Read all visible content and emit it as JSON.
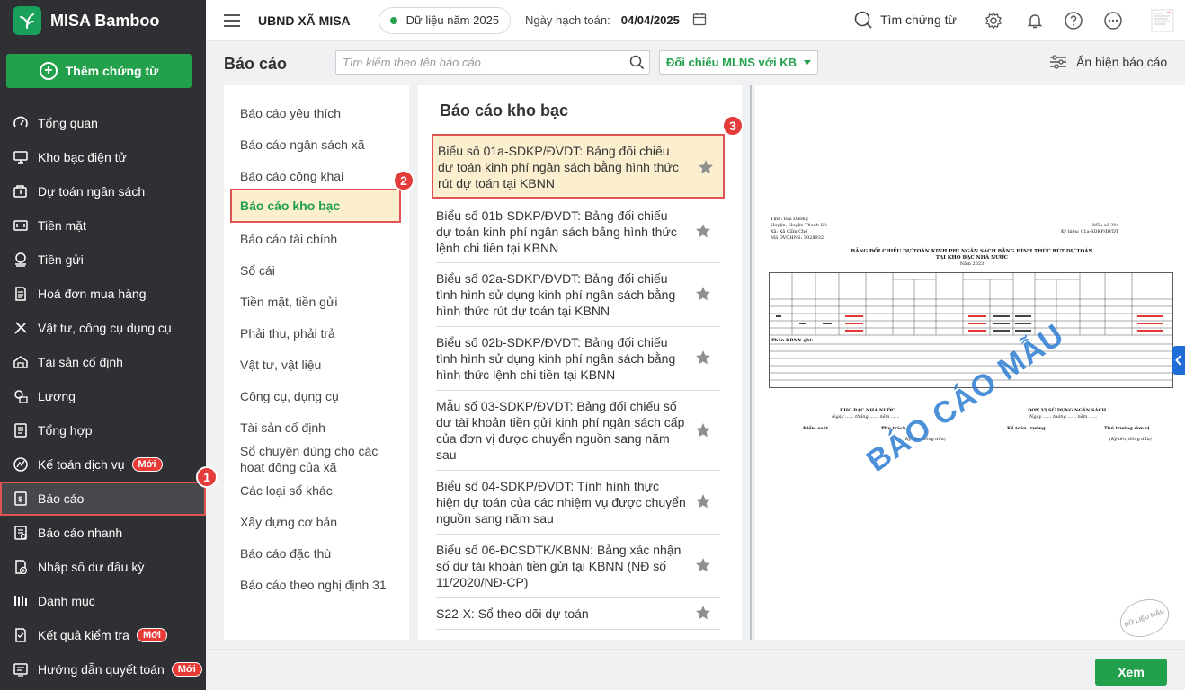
{
  "app": {
    "name": "MISA Bamboo"
  },
  "sidebar": {
    "add_button": "Thêm chứng từ",
    "items": [
      {
        "label": "Tổng quan",
        "icon": "dashboard-icon"
      },
      {
        "label": "Kho bạc điện tử",
        "icon": "monitor-icon"
      },
      {
        "label": "Dự toán ngân sách",
        "icon": "budget-icon"
      },
      {
        "label": "Tiền mặt",
        "icon": "cash-icon"
      },
      {
        "label": "Tiền gửi",
        "icon": "coins-icon"
      },
      {
        "label": "Hoá đơn mua hàng",
        "icon": "invoice-icon"
      },
      {
        "label": "Vật tư, công cụ dụng cụ",
        "icon": "tools-icon"
      },
      {
        "label": "Tài sản cố định",
        "icon": "building-icon"
      },
      {
        "label": "Lương",
        "icon": "salary-icon"
      },
      {
        "label": "Tổng hợp",
        "icon": "summary-icon"
      },
      {
        "label": "Kế toán dịch vụ",
        "icon": "service-icon",
        "badge": "Mới"
      },
      {
        "label": "Báo cáo",
        "icon": "report-icon",
        "active": true
      },
      {
        "label": "Báo cáo nhanh",
        "icon": "quick-report-icon"
      },
      {
        "label": "Nhập số dư đầu kỳ",
        "icon": "opening-balance-icon"
      },
      {
        "label": "Danh mục",
        "icon": "catalog-icon"
      },
      {
        "label": "Kết quả kiểm tra",
        "icon": "check-result-icon",
        "badge": "Mới"
      },
      {
        "label": "Hướng dẫn quyết toán",
        "icon": "guide-icon",
        "badge": "Mới"
      }
    ]
  },
  "topbar": {
    "org": "UBND XÃ MISA",
    "data_year": "Dữ liệu năm 2025",
    "posting_date_label": "Ngày hạch toán:",
    "posting_date": "04/04/2025",
    "search_label": "Tìm chứng từ"
  },
  "header": {
    "title": "Báo cáo",
    "search_placeholder": "Tìm kiếm theo tên báo cáo",
    "dropdown": "Đối chiếu MLNS với KB",
    "toggle_label": "Ẩn hiện báo cáo"
  },
  "categories": [
    "Báo cáo yêu thích",
    "Báo cáo ngân sách xã",
    "Báo cáo công khai",
    "Báo cáo kho bạc",
    "Báo cáo tài chính",
    "Sổ cái",
    "Tiền mặt, tiền gửi",
    "Phải thu, phải trả",
    "Vật tư, vật liệu",
    "Công cụ, dụng cụ",
    "Tài sản cố định",
    "Sổ chuyên dùng cho các hoạt động của xã",
    "Các loại sổ khác",
    "Xây dựng cơ bản",
    "Báo cáo đặc thù",
    "Báo cáo theo nghị định 31"
  ],
  "report_list": {
    "title": "Báo cáo kho bạc",
    "items": [
      "Biểu số 01a-SDKP/ĐVDT: Bảng đối chiếu dự toán kinh phí ngân sách bằng hình thức rút dự toán tại KBNN",
      "Biểu số 01b-SDKP/ĐVDT: Bảng đối chiếu dự toán kinh phí ngân sách bằng hình thức lệnh chi tiền tại KBNN",
      "Biểu số 02a-SDKP/ĐVDT: Bảng đối chiếu tình hình sử dụng kinh phí ngân sách bằng hình thức rút dự toán tại KBNN",
      "Biểu số 02b-SDKP/ĐVDT: Bảng đối chiếu tình hình sử dụng kinh phí ngân sách bằng hình thức lệnh chi tiền tại KBNN",
      "Mẫu số 03-SDKP/ĐVDT: Bảng đối chiếu số dư tài khoản tiền gửi kinh phí ngân sách cấp của đơn vị được chuyển nguồn sang năm sau",
      "Biểu số 04-SDKP/ĐVDT: Tình hình thực hiện dự toán của các nhiệm vụ được chuyển nguồn sang năm sau",
      "Biểu số 06-ĐCSDTK/KBNN: Bảng xác nhận số dư tài khoản tiền gửi tại KBNN (NĐ số 11/2020/NĐ-CP)",
      "S22-X: Sổ theo dõi dự toán"
    ]
  },
  "steps": [
    "1",
    "2",
    "3"
  ],
  "preview": {
    "tinh": "Tỉnh: Hải Dương",
    "huyen": "Huyện: Huyện Thanh Hà",
    "xa": "Xã: Xã Cẩm Chế",
    "ma_dv": "Mã ĐVQHNS: 3028932",
    "mau_so": "Mẫu số 20a",
    "ky_hieu": "Ký hiệu: 01a-SDKP/ĐVDT",
    "title1": "BẢNG ĐỐI CHIẾU DỰ TOÁN KINH PHÍ NGÂN SÁCH BẰNG HÌNH THỨC RÚT DỰ TOÁN",
    "title2": "TẠI KHO BẠC NHÀ NƯỚC",
    "year": "Năm 2023",
    "ghi_chu_label": "Phần KBNN ghi:",
    "kb_sign": "KHO BẠC NHÀ NƯỚC",
    "dv_sign": "ĐƠN VỊ SỬ DỤNG NGÂN SÁCH",
    "date_line": "Ngày ...... tháng ...... năm ......",
    "kiem_soat": "Kiểm soát",
    "phu_trach": "Phụ trách",
    "ke_toan_truong": "Kế toán trưởng",
    "thu_truong": "Thủ trưởng đơn vị",
    "ky_ten": "(Ký tên, đóng dấu)",
    "watermark": "BÁO CÁO MẪU",
    "seal": "DỮ LIỆU MẪU"
  },
  "footer": {
    "view_button": "Xem"
  },
  "colors": {
    "brand": "#22a04b",
    "sidebar_bg": "#2f3033",
    "highlight": "#fbefd0",
    "step_red": "#e43c3b",
    "watermark": "#2d7dd2"
  }
}
